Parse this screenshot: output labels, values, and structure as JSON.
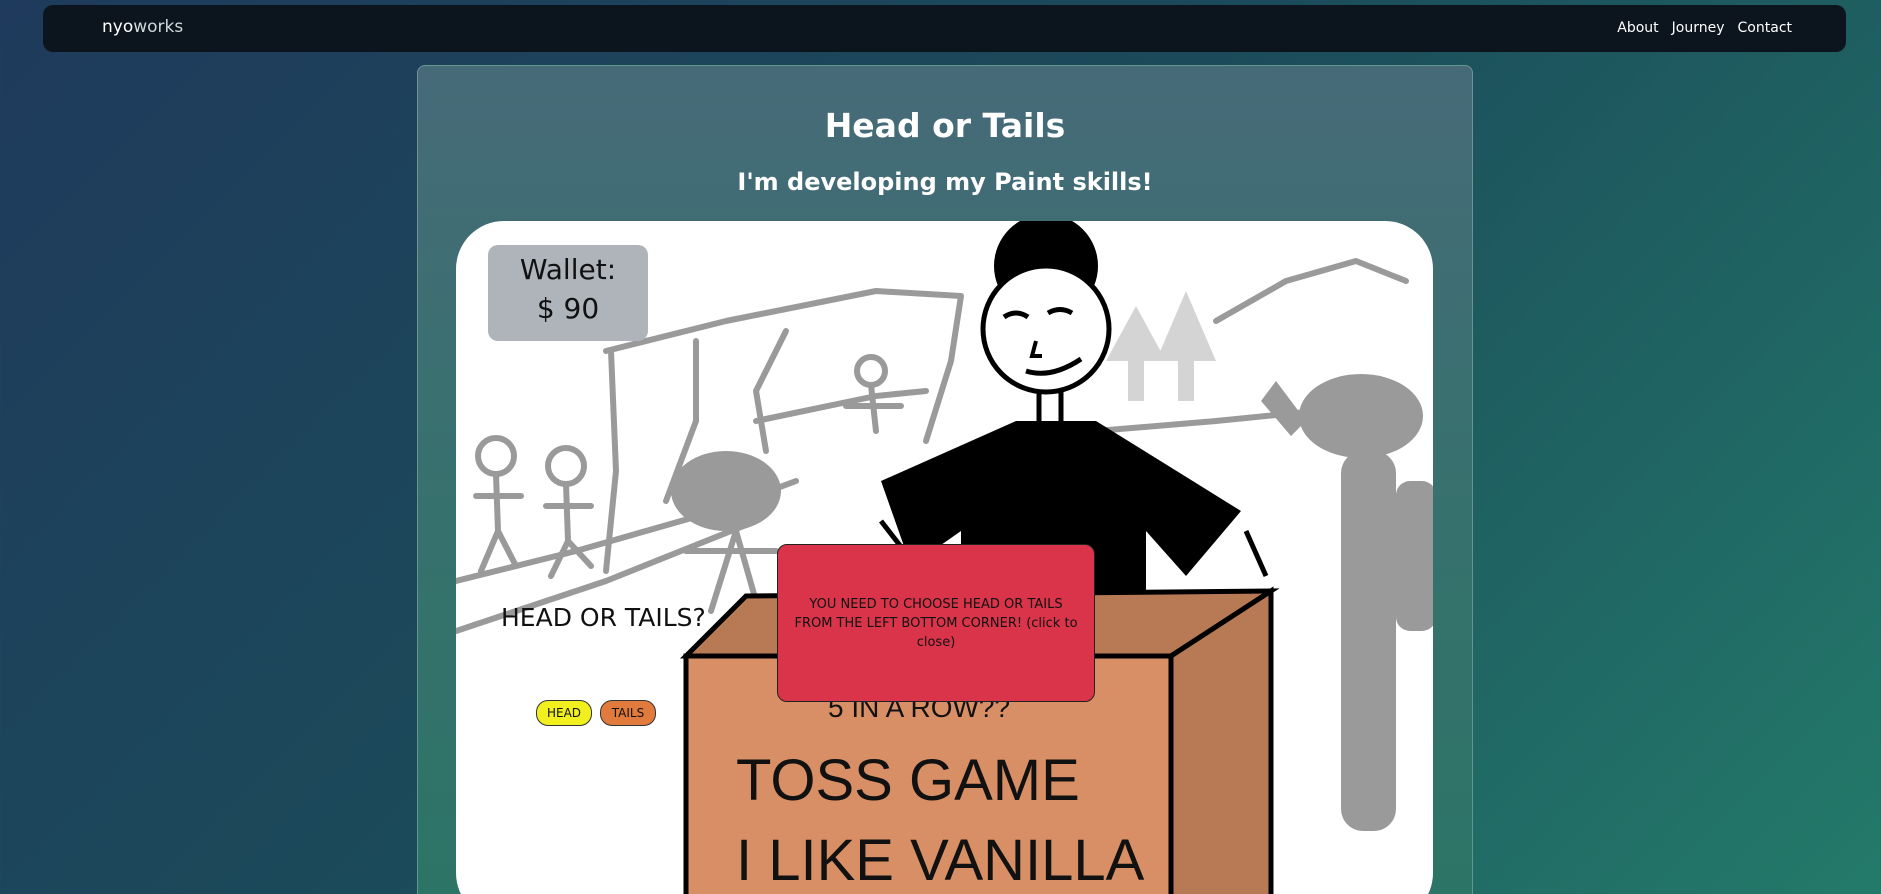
{
  "nav": {
    "brand_part1": "nyo",
    "brand_part2": "works",
    "links": [
      "About",
      "Journey",
      "Contact"
    ]
  },
  "page": {
    "title": "Head or Tails",
    "subtitle": "I'm developing my Paint skills!"
  },
  "game": {
    "wallet_label": "Wallet:",
    "wallet_value": "$ 90",
    "question": "HEAD OR TAILS?",
    "head_label": "HEAD",
    "tails_label": "TAILS",
    "box_line1": "5 IN A ROW??",
    "box_line2": "TOSS GAME",
    "box_line3": "I LIKE VANILLA"
  },
  "popup": {
    "message": "YOU NEED TO CHOOSE HEAD OR TAILS FROM THE LEFT BOTTOM CORNER! (click to close)"
  },
  "colors": {
    "wallet_bg": "#aeb4ba",
    "head_button": "#f2ef1e",
    "tails_button": "#e07a3d",
    "popup_bg": "#d9344a",
    "box_front": "#d98f65",
    "box_side": "#b87a55"
  }
}
